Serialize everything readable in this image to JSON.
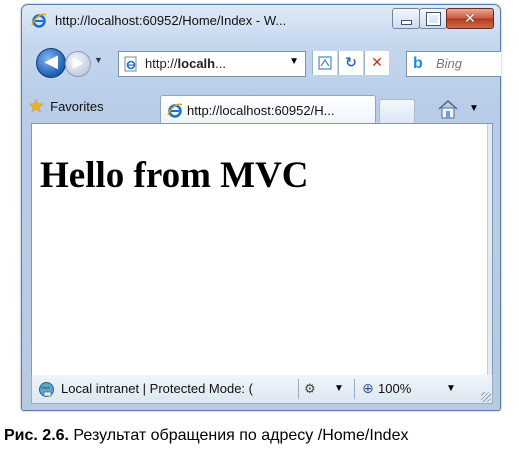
{
  "window": {
    "title": "http://localhost:60952/Home/Index - W...",
    "close_glyph": "✕"
  },
  "nav": {
    "back_glyph": "◀",
    "forward_glyph": "▶",
    "address_prefix": "http://",
    "address_bold": "localh",
    "address_suffix": "...",
    "refresh_glyph": "↻",
    "stop_glyph": "✕",
    "search_provider": "Bing",
    "search_logo": "b"
  },
  "favorites": {
    "label": "Favorites",
    "tab_title": "http://localhost:60952/H..."
  },
  "page": {
    "heading": "Hello from MVC"
  },
  "status": {
    "zone_text": "Local intranet | Protected Mode: (",
    "zoom": "100%"
  },
  "caption": {
    "label": "Рис. 2.6.",
    "text": " Результат обращения по адресу /Home/Index"
  },
  "colors": {
    "frame": "#b9cde8",
    "close_button": "#c8563e",
    "accent_blue": "#1e5cb3"
  }
}
